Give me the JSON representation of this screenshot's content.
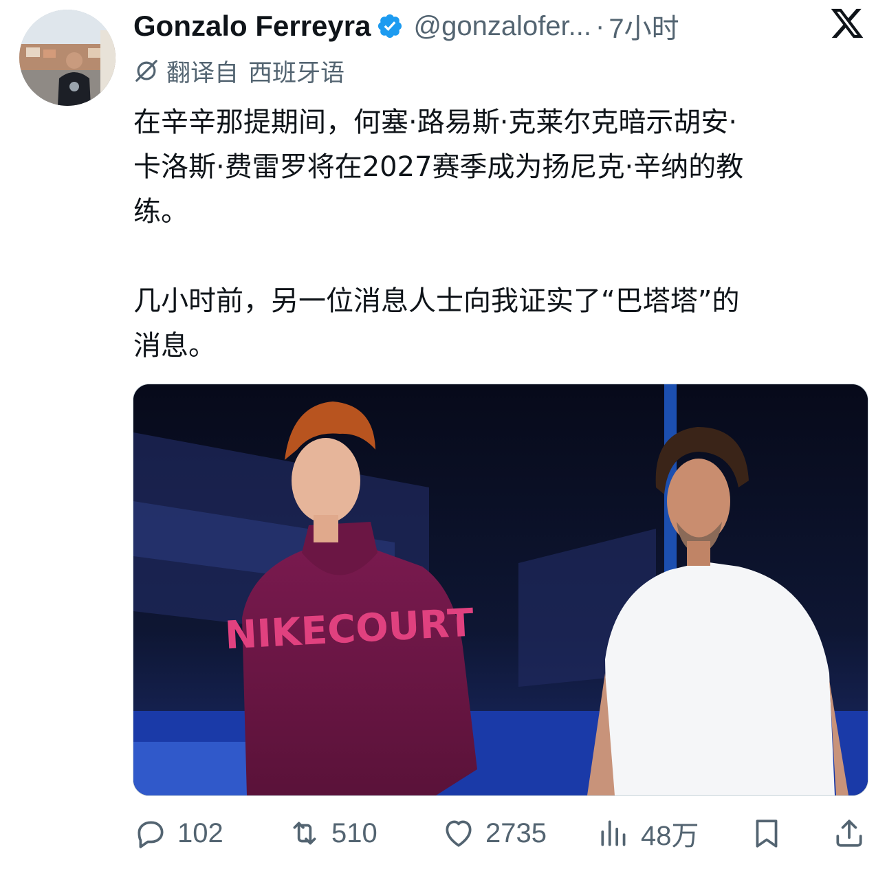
{
  "tweet": {
    "author": {
      "display_name": "Gonzalo Ferreyra",
      "handle": "@gonzalofer...",
      "verified": true,
      "avatar_icon": "profile-photo"
    },
    "separator": "·",
    "time": "7小时",
    "platform_icon": "x-logo-icon",
    "translation": {
      "label": "翻译自",
      "language": "西班牙语",
      "icon": "translate-icon"
    },
    "paragraphs": [
      {
        "lines": [
          "在辛辛那提期间，何塞·路易斯·克莱尔克暗示胡安·",
          "卡洛斯·费雷罗将在2027赛季成为扬尼克·辛纳的教",
          "练。"
        ]
      },
      {
        "lines": [
          "几小时前，另一位消息人士向我证实了“巴塔塔”的",
          "消息。"
        ]
      }
    ],
    "media": {
      "description": "photo",
      "hoodie_text": "NIKECOURT"
    },
    "actions": {
      "reply": {
        "icon": "reply-icon",
        "count": "102"
      },
      "retweet": {
        "icon": "retweet-icon",
        "count": "510"
      },
      "like": {
        "icon": "heart-icon",
        "count": "2735"
      },
      "views": {
        "icon": "views-icon",
        "count": "48万"
      },
      "bookmark": {
        "icon": "bookmark-icon"
      },
      "share": {
        "icon": "share-icon"
      }
    },
    "colors": {
      "text": "#0f1419",
      "secondary": "#536471",
      "verified": "#1d9bf0"
    }
  }
}
